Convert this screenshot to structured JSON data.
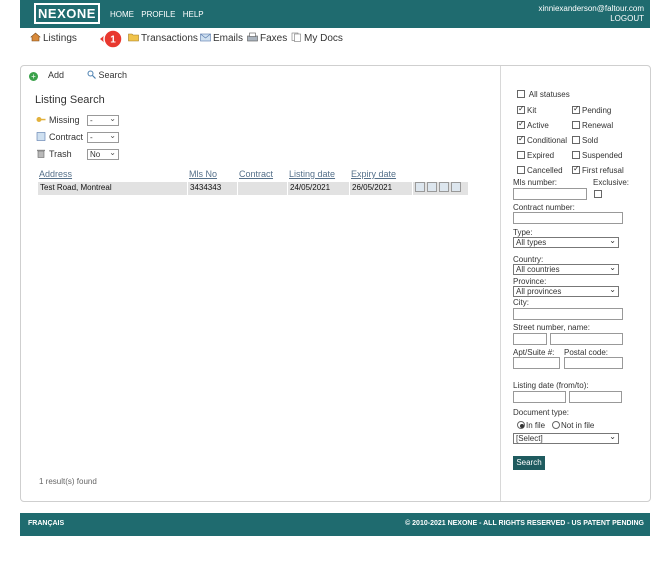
{
  "header": {
    "logo": "NEXONE",
    "nav": [
      "HOME",
      "PROFILE",
      "HELP"
    ],
    "email": "xinniexanderson@faltour.com",
    "logout": "LOGOUT"
  },
  "mainnav": {
    "listings": "Listings",
    "transactions": "Transactions",
    "emails": "Emails",
    "faxes": "Faxes",
    "mydocs": "My Docs",
    "badge": "1"
  },
  "toolbar": {
    "add": "Add",
    "search": "Search"
  },
  "listing": {
    "title": "Listing Search",
    "filters": [
      {
        "label": "Missing",
        "value": "-"
      },
      {
        "label": "Contract",
        "value": "-"
      },
      {
        "label": "Trash",
        "value": "No"
      }
    ],
    "columns": [
      "Address",
      "Mls No",
      "Contract",
      "Listing date",
      "Expiry date"
    ],
    "rows": [
      {
        "address": "Test Road, Montreal",
        "mls": "3434343",
        "contract": "",
        "listing_date": "24/05/2021",
        "expiry_date": "26/05/2021"
      }
    ],
    "results": "1 result(s) found"
  },
  "sidebar": {
    "all_statuses": "All statuses",
    "statuses": [
      {
        "label": "Kit",
        "checked": true
      },
      {
        "label": "Pending",
        "checked": true
      },
      {
        "label": "Active",
        "checked": true
      },
      {
        "label": "Renewal",
        "checked": false
      },
      {
        "label": "Conditional",
        "checked": true
      },
      {
        "label": "Sold",
        "checked": false
      },
      {
        "label": "Expired",
        "checked": false
      },
      {
        "label": "Suspended",
        "checked": false
      },
      {
        "label": "Cancelled",
        "checked": false
      },
      {
        "label": "First refusal",
        "checked": true
      }
    ],
    "mls_label": "Mls number:",
    "exclusive_label": "Exclusive:",
    "contract_label": "Contract number:",
    "type_label": "Type:",
    "type_value": "All types",
    "country_label": "Country:",
    "country_value": "All countries",
    "province_label": "Province:",
    "province_value": "All provinces",
    "city_label": "City:",
    "street_label": "Street number, name:",
    "apt_label": "Apt/Suite #:",
    "postal_label": "Postal code:",
    "listing_date_label": "Listing date (from/to):",
    "doc_type_label": "Document type:",
    "in_file": "In file",
    "not_in_file": "Not in file",
    "select_value": "[Select]",
    "search_button": "Search"
  },
  "footer": {
    "language": "FRANÇAIS",
    "copyright": "© 2010-2021 NEXONE - ALL RIGHTS RESERVED - US PATENT PENDING"
  }
}
